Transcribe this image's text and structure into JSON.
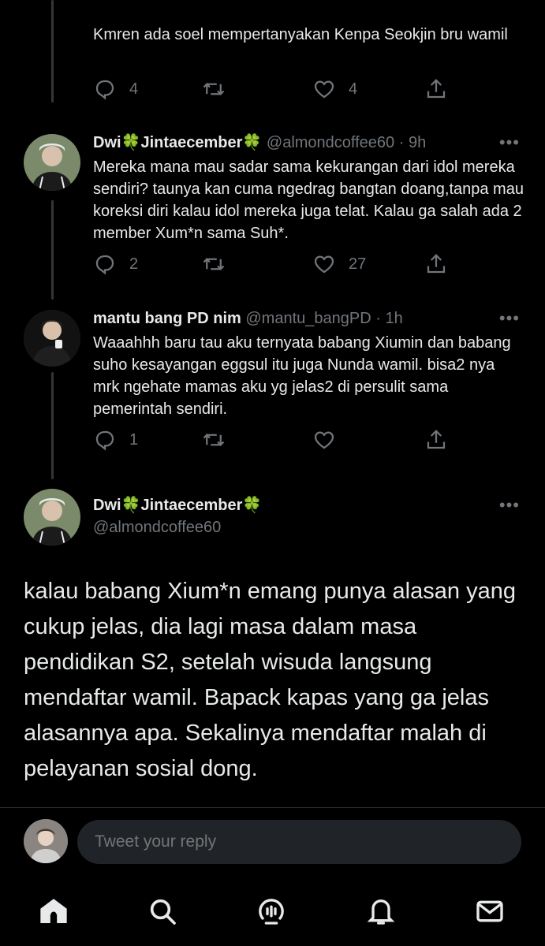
{
  "tweets": [
    {
      "text": "Kmren ada soel mempertanyakan Kenpa Seokjin bru wamil",
      "reply_count": "4",
      "retweet_count": "",
      "like_count": "4"
    },
    {
      "name": "Dwi🍀Jintaecember🍀",
      "handle": "@almondcoffee60",
      "dot": "·",
      "time": "9h",
      "text": "Mereka mana mau sadar sama kekurangan dari idol mereka sendiri? taunya kan cuma ngedrag bangtan doang,tanpa mau koreksi diri kalau idol mereka juga telat. Kalau ga salah ada 2 member Xum*n sama Suh*.",
      "reply_count": "2",
      "retweet_count": "",
      "like_count": "27"
    },
    {
      "name": "mantu bang PD nim",
      "handle": "@mantu_bangPD",
      "dot": "·",
      "time": "1h",
      "text": "Waaahhh baru tau aku ternyata babang Xiumin dan babang suho kesayangan eggsul itu juga Nunda wamil. bisa2 nya mrk ngehate mamas aku yg jelas2 di persulit sama pemerintah sendiri.",
      "reply_count": "1",
      "retweet_count": "",
      "like_count": ""
    }
  ],
  "main_tweet": {
    "name": "Dwi🍀Jintaecember🍀",
    "handle": "@almondcoffee60",
    "text": "kalau babang Xium*n emang punya alasan yang cukup jelas, dia lagi masa dalam masa pendidikan S2, setelah wisuda langsung mendaftar wamil. Bapack kapas yang ga jelas alasannya apa. Sekalinya mendaftar malah di pelayanan sosial dong."
  },
  "reply_bar": {
    "placeholder": "Tweet your reply"
  },
  "more_label": "•••",
  "nav": [
    "home-icon",
    "search-icon",
    "spaces-icon",
    "notifications-icon",
    "messages-icon"
  ],
  "colors": {
    "background": "#000000",
    "text": "#e7e9ea",
    "muted": "#71767b",
    "input_bg": "#202327"
  }
}
